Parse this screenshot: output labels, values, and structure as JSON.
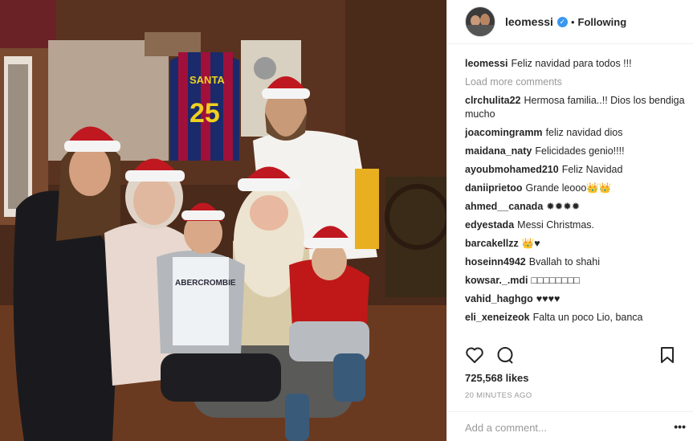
{
  "post": {
    "username": "leomessi",
    "follow_status": "Following",
    "caption_user": "leomessi",
    "caption_text": "Feliz navidad para todos !!!",
    "load_more": "Load more comments",
    "comments": [
      {
        "user": "clrchulita22",
        "text": "Hermosa familia..!! Dios los bendiga mucho"
      },
      {
        "user": "joacomingramm",
        "text": "feliz navidad dios"
      },
      {
        "user": "maidana_naty",
        "text": "Felicidades genio!!!!"
      },
      {
        "user": "ayoubmohamed210",
        "text": "Feliz Navidad"
      },
      {
        "user": "daniiprietoo",
        "text": "Grande leooo👑👑"
      },
      {
        "user": "ahmed__canada",
        "text": "✹✹✹✹"
      },
      {
        "user": "edyestada",
        "text": "Messi Christmas."
      },
      {
        "user": "barcakellzz",
        "text": "👑♥"
      },
      {
        "user": "hoseinn4942",
        "text": "Bvallah to shahi"
      },
      {
        "user": "kowsar._.mdi",
        "text": "□□□□□□□□"
      },
      {
        "user": "vahid_haghgo",
        "text": "♥♥♥♥"
      },
      {
        "user": "eli_xeneizeok",
        "text": "Falta un poco Lio, banca"
      }
    ],
    "likes": "725,568 likes",
    "time": "20 MINUTES AGO",
    "add_comment_placeholder": "Add a comment...",
    "more_label": "•••"
  },
  "photo": {
    "jersey_name": "SANTA",
    "jersey_number": "25",
    "shirt_text": "ABERCROMBIE"
  },
  "icons": [
    "heart-icon",
    "comment-icon",
    "bookmark-icon",
    "verified-icon"
  ]
}
